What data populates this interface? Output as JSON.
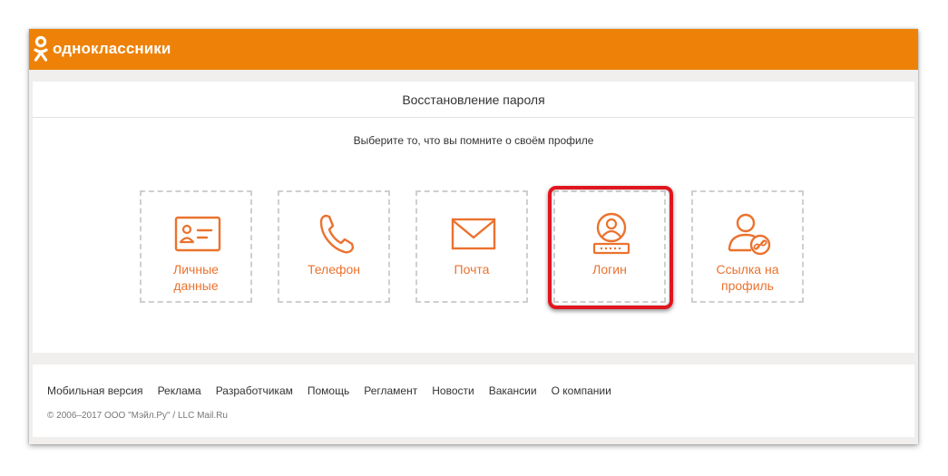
{
  "header": {
    "logo_text": "одноклассники",
    "brand_color": "#ee8208"
  },
  "recovery": {
    "title": "Восстановление пароля",
    "subtitle": "Выберите то, что вы помните о своём профиле",
    "accent_color": "#eb722e",
    "options": [
      {
        "label_line1": "Личные",
        "label_line2": "данные",
        "icon": "id-card-icon"
      },
      {
        "label_line1": "Телефон",
        "label_line2": "",
        "icon": "phone-icon"
      },
      {
        "label_line1": "Почта",
        "label_line2": "",
        "icon": "envelope-icon"
      },
      {
        "label_line1": "Логин",
        "label_line2": "",
        "icon": "user-login-icon",
        "highlighted": true
      },
      {
        "label_line1": "Ссылка на",
        "label_line2": "профиль",
        "icon": "profile-link-icon"
      }
    ],
    "highlight_color": "#e0161f"
  },
  "footer": {
    "links": [
      "Мобильная версия",
      "Реклама",
      "Разработчикам",
      "Помощь",
      "Регламент",
      "Новости",
      "Вакансии",
      "О компании"
    ],
    "copyright": "© 2006–2017 ООО \"Мэйл.Ру\" / LLC Mail.Ru"
  }
}
